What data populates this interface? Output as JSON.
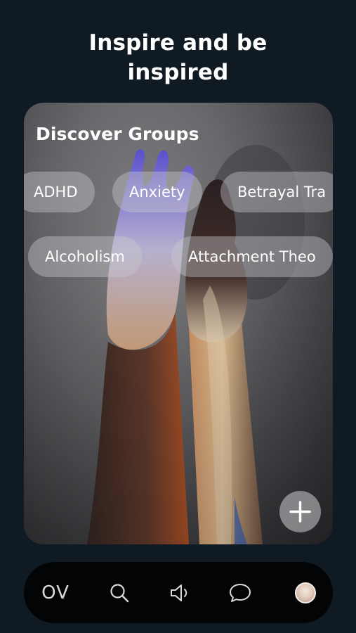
{
  "header": {
    "title": "Inspire and be\ninspired"
  },
  "card": {
    "title": "Discover Groups",
    "image": "hands-reaching-photo",
    "groups_row1": [
      "ADHD",
      "Anxiety",
      "Betrayal Tra"
    ],
    "groups_row2": [
      "Alcoholism",
      "Attachment Theo"
    ],
    "add_button_icon": "plus-icon"
  },
  "nav": {
    "logo": "OV",
    "items": [
      "search-icon",
      "megaphone-icon",
      "chat-bubble-icon",
      "profile-avatar"
    ]
  },
  "colors": {
    "background": "#0f1a23",
    "navbar": "#020406",
    "chip": "#c8c8cc"
  }
}
